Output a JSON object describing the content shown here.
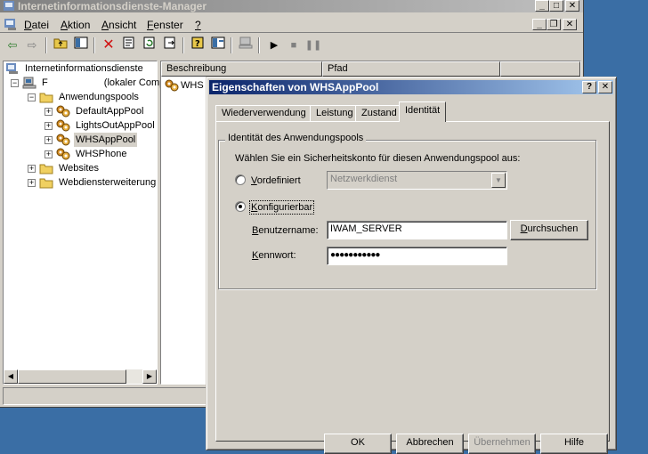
{
  "main_window": {
    "title": "Internetinformationsdienste-Manager",
    "menu": [
      {
        "label": "Datei",
        "key": "D",
        "rest": "atei"
      },
      {
        "label": "Aktion",
        "key": "A",
        "rest": "ktion"
      },
      {
        "label": "Ansicht",
        "key": "A",
        "rest": "nsicht"
      },
      {
        "label": "Fenster",
        "key": "F",
        "rest": "enster"
      },
      {
        "label": "?",
        "key": "?",
        "rest": ""
      }
    ]
  },
  "tree": {
    "root": "Internetinformationsdienste",
    "computer": "F",
    "computer_suffix": "(lokaler Comp",
    "app_pools": "Anwendungspools",
    "pools": [
      "DefaultAppPool",
      "LightsOutAppPool",
      "WHSAppPool",
      "WHSPhone"
    ],
    "websites": "Websites",
    "web_extensions": "Webdiensterweiterung"
  },
  "list": {
    "col_description": "Beschreibung",
    "col_path": "Pfad",
    "row_description": "WHS A"
  },
  "dialog": {
    "title": "Eigenschaften von WHSAppPool",
    "tabs": [
      "Wiederverwendung",
      "Leistung",
      "Zustand",
      "Identität"
    ],
    "active_tab": "Identität",
    "group_title": "Identität des Anwendungspools",
    "instruction": "Wählen Sie ein Sicherheitskonto für diesen Anwendungspool aus:",
    "predefined": {
      "key": "V",
      "rest": "ordefiniert",
      "value": "Netzwerkdienst"
    },
    "configurable": {
      "key": "K",
      "rest": "onfigurierbar"
    },
    "username": {
      "key": "B",
      "rest": "enutzername:",
      "value": "IWAM_SERVER"
    },
    "password": {
      "key": "K",
      "rest": "ennwort:",
      "value": "●●●●●●●●●●●"
    },
    "browse_button": {
      "key": "D",
      "rest": "urchsuchen"
    },
    "bottom_buttons": [
      "OK",
      "Abbrechen",
      "Übernehmen",
      "Hilfe"
    ]
  },
  "colors": {
    "title_active": "#0a246a",
    "title_inactive": "#808080",
    "face": "#d4d0c8",
    "desktop": "#3a6ea5"
  }
}
